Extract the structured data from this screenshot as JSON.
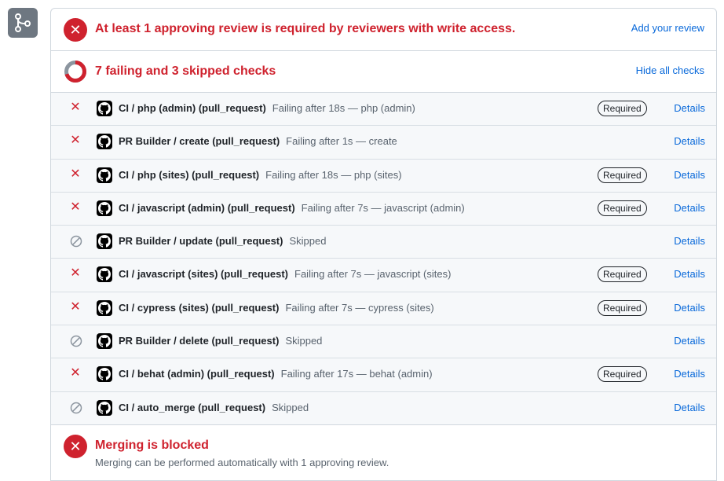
{
  "review": {
    "title": "At least 1 approving review is required by reviewers with write access.",
    "action": "Add your review",
    "status_icon": "x-circle-icon"
  },
  "checks": {
    "title": "7 failing and 3 skipped checks",
    "action": "Hide all checks",
    "summary_icon": "donut-status-icon",
    "failing": 7,
    "skipped": 3,
    "items": [
      {
        "status": "failing",
        "name": "CI / php (admin) (pull_request)",
        "description": "Failing after 18s — php (admin)",
        "required": "Required",
        "details": "Details"
      },
      {
        "status": "failing",
        "name": "PR Builder / create (pull_request)",
        "description": "Failing after 1s — create",
        "required": "",
        "details": "Details"
      },
      {
        "status": "failing",
        "name": "CI / php (sites) (pull_request)",
        "description": "Failing after 18s — php (sites)",
        "required": "Required",
        "details": "Details"
      },
      {
        "status": "failing",
        "name": "CI / javascript (admin) (pull_request)",
        "description": "Failing after 7s — javascript (admin)",
        "required": "Required",
        "details": "Details"
      },
      {
        "status": "skipped",
        "name": "PR Builder / update (pull_request)",
        "description": "Skipped",
        "required": "",
        "details": "Details"
      },
      {
        "status": "failing",
        "name": "CI / javascript (sites) (pull_request)",
        "description": "Failing after 7s — javascript (sites)",
        "required": "Required",
        "details": "Details"
      },
      {
        "status": "failing",
        "name": "CI / cypress (sites) (pull_request)",
        "description": "Failing after 7s — cypress (sites)",
        "required": "Required",
        "details": "Details"
      },
      {
        "status": "skipped",
        "name": "PR Builder / delete (pull_request)",
        "description": "Skipped",
        "required": "",
        "details": "Details"
      },
      {
        "status": "failing",
        "name": "CI / behat (admin) (pull_request)",
        "description": "Failing after 17s — behat (admin)",
        "required": "Required",
        "details": "Details"
      },
      {
        "status": "skipped",
        "name": "CI / auto_merge (pull_request)",
        "description": "Skipped",
        "required": "",
        "details": "Details"
      }
    ]
  },
  "merge": {
    "title": "Merging is blocked",
    "subtitle": "Merging can be performed automatically with 1 approving review.",
    "status_icon": "x-circle-icon"
  },
  "colors": {
    "danger": "#cf222e",
    "link": "#0969da",
    "muted": "#59636e",
    "skipped": "#8c959f"
  }
}
